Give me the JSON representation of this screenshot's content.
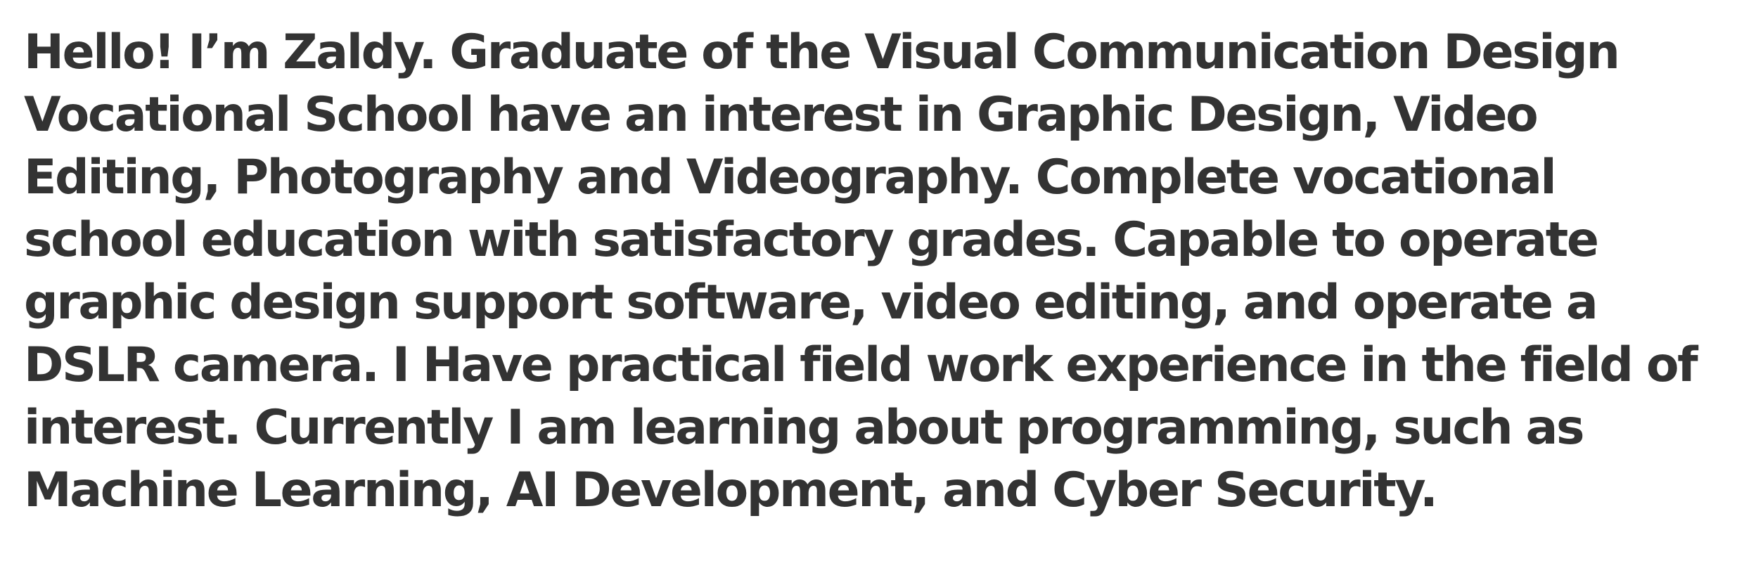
{
  "bio": {
    "lines": [
      "Hello! I’m Zaldy. Graduate of the Visual Communication Design",
      "Vocational School have an interest in Graphic Design, Video",
      "Editing, Photography and Videography. Complete vocational",
      "school education with satisfactory grades. Capable to operate",
      "graphic design support software, video editing, and operate a",
      "DSLR camera. I Have practical field work experience in the field of",
      "interest. Currently I am learning about programming, such as",
      "Machine Learning, AI Development, and Cyber Security."
    ]
  },
  "colors": {
    "text": "#333333",
    "background": "#ffffff"
  }
}
